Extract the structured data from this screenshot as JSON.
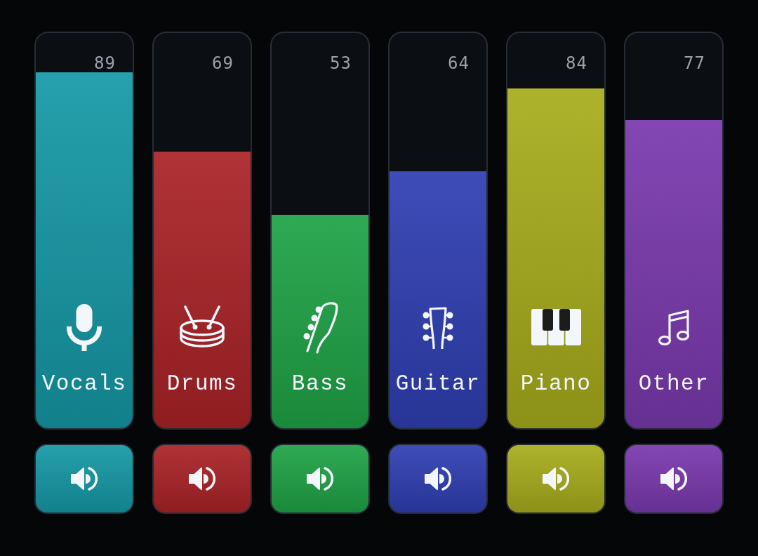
{
  "channels": [
    {
      "name": "Vocals",
      "kind": "vocals",
      "reading": "89",
      "level": 0.9,
      "color": "#1599a6",
      "muted": false
    },
    {
      "name": "Drums",
      "kind": "drums",
      "reading": "69",
      "level": 0.7,
      "color": "#aa2327",
      "muted": false
    },
    {
      "name": "Bass",
      "kind": "bass",
      "reading": "53",
      "level": 0.54,
      "color": "#1fa346",
      "muted": false
    },
    {
      "name": "Guitar",
      "kind": "guitar",
      "reading": "64",
      "level": 0.65,
      "color": "#2f3fb3",
      "muted": false
    },
    {
      "name": "Piano",
      "kind": "piano",
      "reading": "84",
      "level": 0.86,
      "color": "#a7ad1c",
      "muted": false
    },
    {
      "name": "Other",
      "kind": "other",
      "reading": "77",
      "level": 0.78,
      "color": "#7a39ae",
      "muted": false
    }
  ]
}
